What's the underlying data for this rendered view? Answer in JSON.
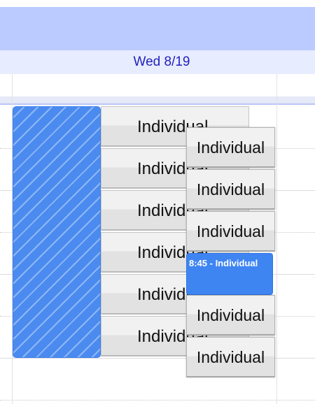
{
  "calendar": {
    "day_header": "Wed 8/19"
  },
  "events": {
    "column1": [
      {
        "title": "Individual"
      },
      {
        "title": "Individual"
      },
      {
        "title": "Individual"
      },
      {
        "title": "Individual"
      },
      {
        "title": "Individual"
      },
      {
        "title": "Individual"
      }
    ],
    "column2": [
      {
        "title": "Individual"
      },
      {
        "title": "Individual"
      },
      {
        "title": "Individual"
      },
      {
        "title": "Individual"
      },
      {
        "title": "Individual"
      }
    ],
    "active": {
      "label": "8:45 - Individual"
    }
  },
  "colors": {
    "header_band": "#bccbff",
    "day_header_bg": "#e8ecff",
    "day_header_text": "#2222bb",
    "blocked": "#4b8bf0",
    "active_event": "#3f85f2"
  }
}
